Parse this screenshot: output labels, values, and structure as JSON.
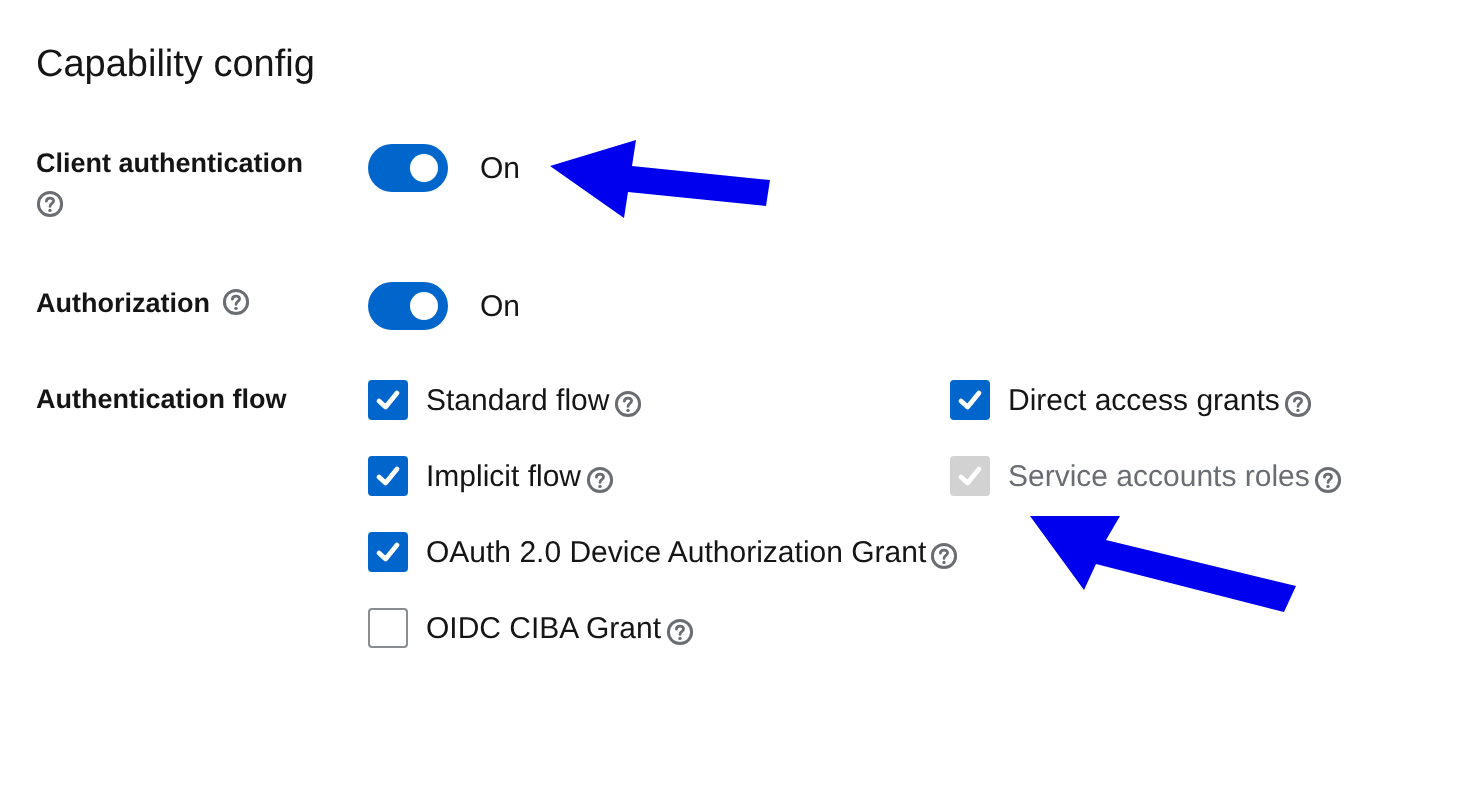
{
  "section": {
    "title": "Capability config"
  },
  "fields": [
    {
      "kind": "switch",
      "label": "Client authentication",
      "on": true,
      "state_text": "On"
    },
    {
      "kind": "switch",
      "label": "Authorization",
      "on": true,
      "state_text": "On"
    },
    {
      "kind": "checkboxes",
      "label": "Authentication flow",
      "rows": [
        [
          {
            "label": "Standard flow",
            "checked": true,
            "disabled": false
          },
          {
            "label": "Direct access grants",
            "checked": true,
            "disabled": false
          }
        ],
        [
          {
            "label": "Implicit flow",
            "checked": true,
            "disabled": false
          },
          {
            "label": "Service accounts roles",
            "checked": true,
            "disabled": true
          }
        ],
        [
          {
            "label": "OAuth 2.0 Device Authorization Grant",
            "checked": true,
            "disabled": false
          }
        ],
        [
          {
            "label": "OIDC CIBA Grant",
            "checked": false,
            "disabled": false
          }
        ]
      ]
    }
  ]
}
